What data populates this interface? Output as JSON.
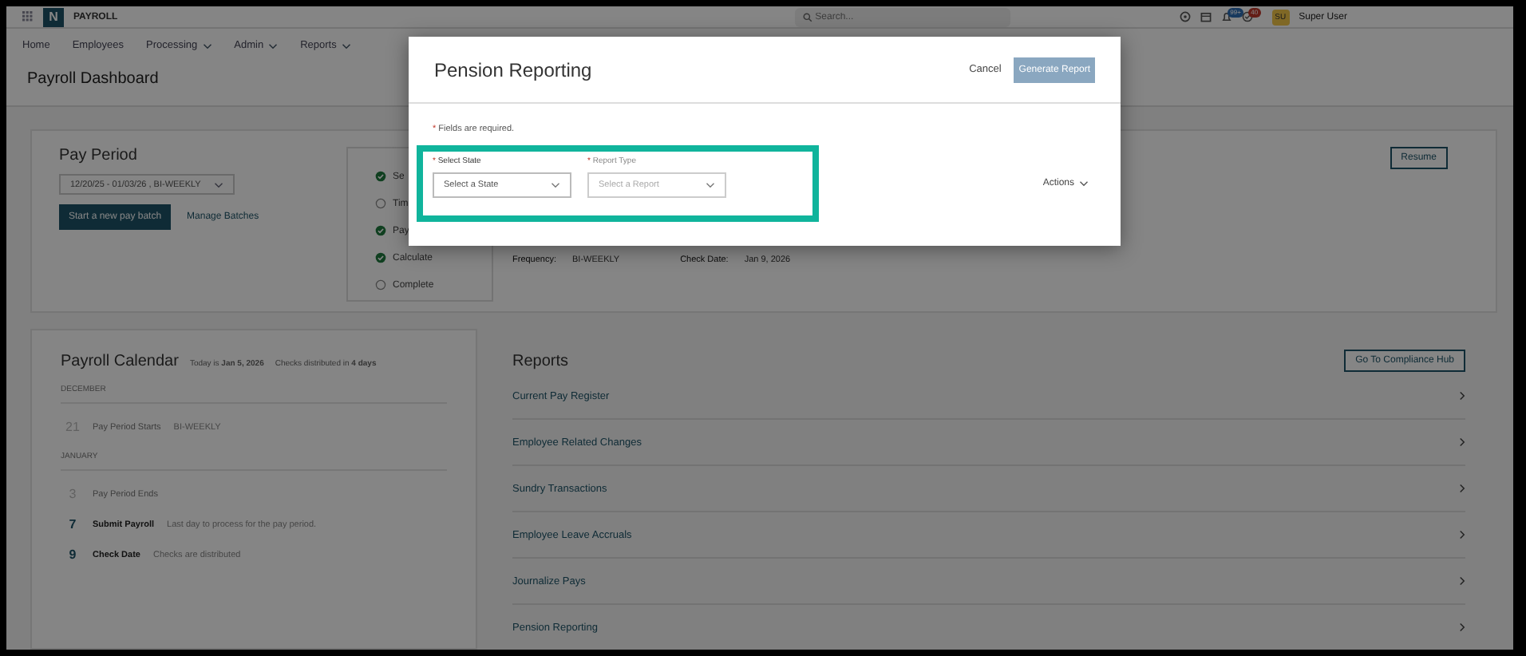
{
  "topbar": {
    "app_name": "PAYROLL",
    "logo_letter": "N",
    "search": {
      "placeholder": "Search..."
    },
    "badges": [
      "99+",
      "40"
    ],
    "avatar": "SU",
    "user": "Super User"
  },
  "nav": [
    {
      "label": "Home",
      "dropdown": false
    },
    {
      "label": "Employees",
      "dropdown": false
    },
    {
      "label": "Processing",
      "dropdown": true
    },
    {
      "label": "Admin",
      "dropdown": true
    },
    {
      "label": "Reports",
      "dropdown": true
    }
  ],
  "page_title": "Payroll Dashboard",
  "pay_period": {
    "title": "Pay Period",
    "period": "12/20/25 - 01/03/26 , BI-WEEKLY",
    "start_button": "Start a new pay batch",
    "manage_link": "Manage Batches",
    "steps": [
      {
        "label": "Se",
        "done": true
      },
      {
        "label": "Tim",
        "done": false
      },
      {
        "label": "Pay",
        "done": true
      },
      {
        "label": "Calculate",
        "done": true
      },
      {
        "label": "Complete",
        "done": false
      }
    ],
    "details": [
      {
        "label": "Frequency:",
        "value": "BI-WEEKLY"
      },
      {
        "label": "Check Date:",
        "value": "Jan 9, 2026"
      }
    ],
    "resume_button": "Resume"
  },
  "calendar": {
    "title": "Payroll Calendar",
    "today": "Today is **Jan 5, 2026**",
    "distributed": "Checks distributed in **4 days**",
    "months": [
      {
        "name": "DECEMBER",
        "events": [
          {
            "day": "21",
            "title": "Pay Period Starts",
            "note": "BI-WEEKLY",
            "past": true
          }
        ]
      },
      {
        "name": "JANUARY",
        "events": [
          {
            "day": "3",
            "title": "Pay Period Ends",
            "past": true
          },
          {
            "day": "7",
            "title": "Submit Payroll",
            "note": "Last day to process for the pay period.",
            "past": false
          },
          {
            "day": "9",
            "title": "Check Date",
            "note": "Checks are distributed",
            "past": false
          }
        ]
      }
    ]
  },
  "reports": {
    "title": "Reports",
    "hub_button": "Go To Compliance Hub",
    "items": [
      "Current Pay Register",
      "Employee Related Changes",
      "Sundry Transactions",
      "Employee Leave Accruals",
      "Journalize Pays",
      "Pension Reporting"
    ]
  },
  "modal": {
    "title": "Pension Reporting",
    "cancel": "Cancel",
    "generate": "Generate Report",
    "generate_disabled": true,
    "required_mark": "*",
    "required_note": "Fields are required.",
    "fields": [
      {
        "mark": "*",
        "label": "Select State",
        "placeholder": "Select a State",
        "disabled": false
      },
      {
        "mark": "*",
        "label": "Report Type",
        "placeholder": "Select a Report",
        "disabled": true
      }
    ],
    "actions": "Actions"
  }
}
